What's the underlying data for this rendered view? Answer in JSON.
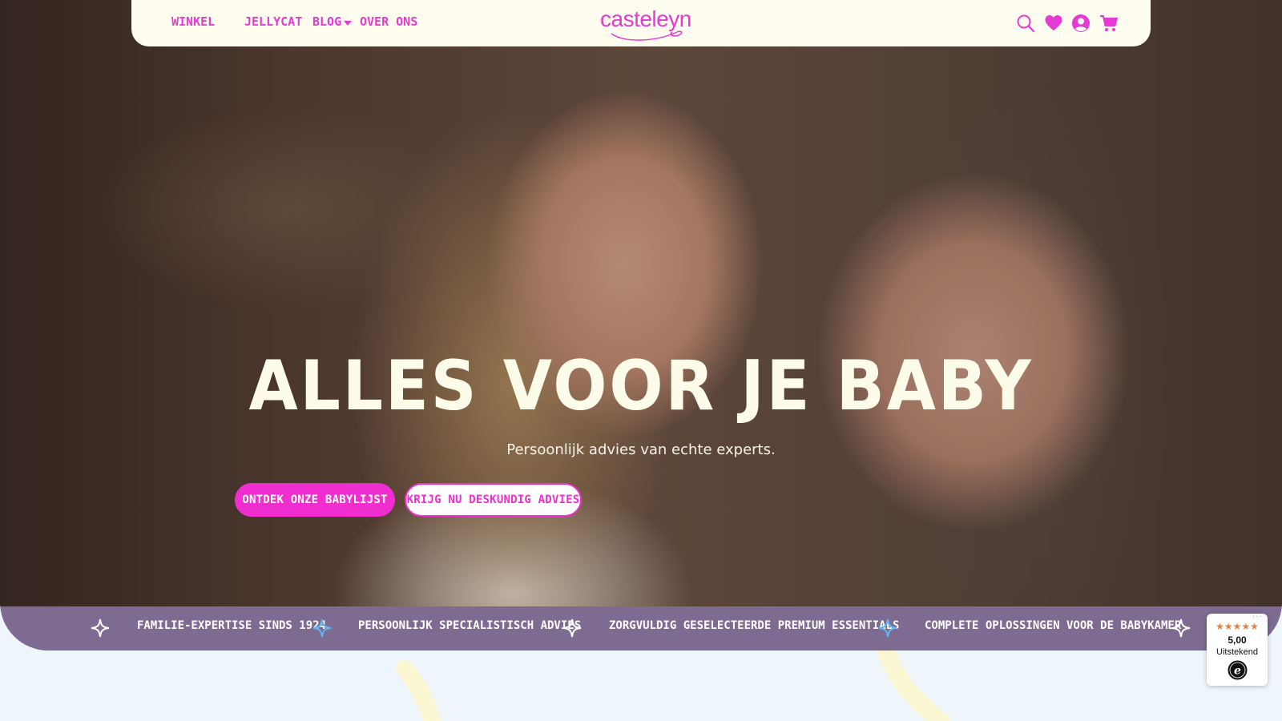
{
  "header": {
    "nav": [
      {
        "label": "WINKEL",
        "has_dropdown": true
      },
      {
        "label": "JELLYCAT"
      },
      {
        "label": "BLOG"
      },
      {
        "label": "OVER ONS"
      }
    ],
    "logo_text": "casteleyn",
    "icons": [
      "search-icon",
      "heart-icon",
      "account-icon",
      "cart-icon"
    ]
  },
  "hero": {
    "title": "ALLES VOOR JE BABY",
    "subtitle": "Persoonlijk advies van echte experts.",
    "primary_button": "ONTDEK ONZE BABYLIJST",
    "secondary_button": "KRIJG NU DESKUNDIG ADVIES"
  },
  "ticker": {
    "items": [
      "FAMILIE-EXPERTISE SINDS 1924",
      "PERSOONLIJK SPECIALISTISCH ADVIES",
      "ZORGVULDIG GESELECTEERDE PREMIUM ESSENTIALS",
      "COMPLETE OPLOSSINGEN VOOR DE BABYKAMER"
    ]
  },
  "review_badge": {
    "stars": "★★★★★",
    "rating": 5.0,
    "score": "5,00",
    "label": "Uitstekend",
    "icon": "trusted-shops-e-icon"
  },
  "colors": {
    "brand_pink": "#f02ed0",
    "header_bg": "#fefdef",
    "ticker_bg": "#7d6b91",
    "page_bg": "#eef6fb",
    "hero_text": "#fdfbe9",
    "star_orange": "#e3823a"
  }
}
